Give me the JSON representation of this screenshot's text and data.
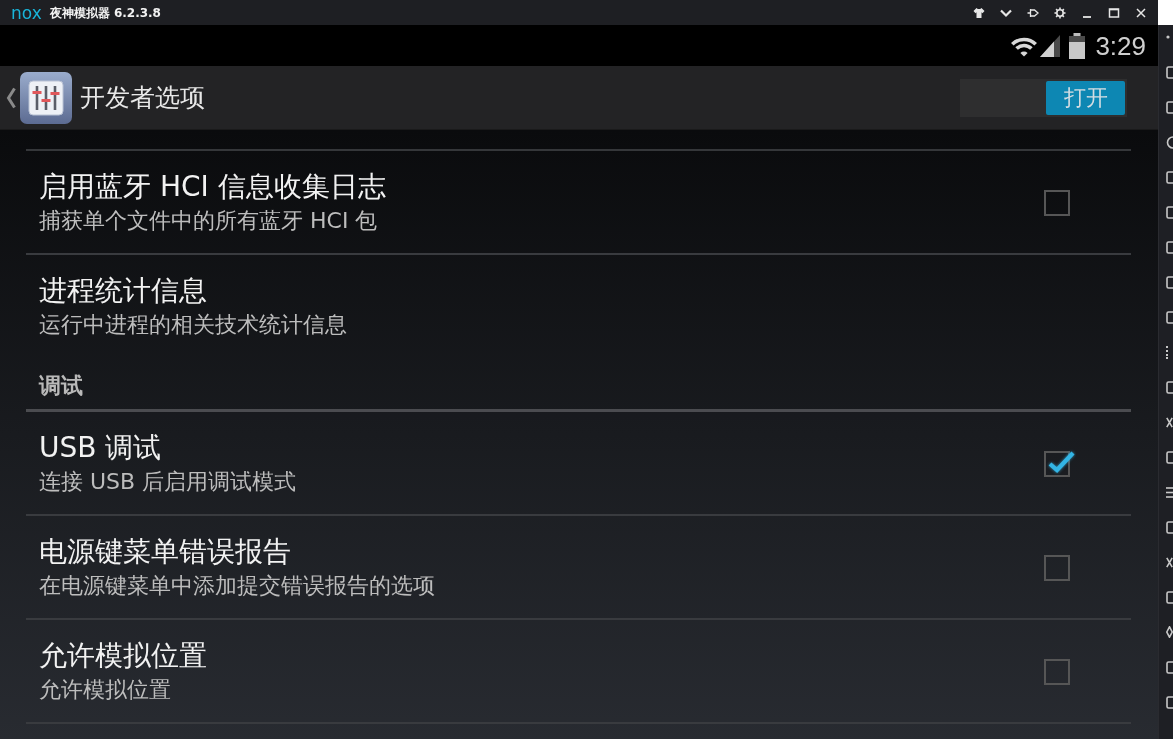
{
  "window": {
    "logo": "nox",
    "title": "夜神模拟器 6.2.3.8"
  },
  "status_bar": {
    "time": "3:29"
  },
  "action_bar": {
    "title": "开发者选项",
    "switch": {
      "label": "打开",
      "on": true
    }
  },
  "settings": [
    {
      "kind": "checkbox",
      "title": "启用蓝牙 HCI 信息收集日志",
      "summary": "捕获单个文件中的所有蓝牙 HCI 包",
      "checked": false
    },
    {
      "kind": "plain",
      "title": "进程统计信息",
      "summary": "运行中进程的相关技术统计信息"
    },
    {
      "kind": "header",
      "title": "调试"
    },
    {
      "kind": "checkbox",
      "title": "USB 调试",
      "summary": "连接 USB 后启用调试模式",
      "checked": true
    },
    {
      "kind": "checkbox",
      "title": "电源键菜单错误报告",
      "summary": "在电源键菜单中添加提交错误报告的选项",
      "checked": false
    },
    {
      "kind": "checkbox",
      "title": "允许模拟位置",
      "summary": "允许模拟位置",
      "checked": false
    }
  ]
}
